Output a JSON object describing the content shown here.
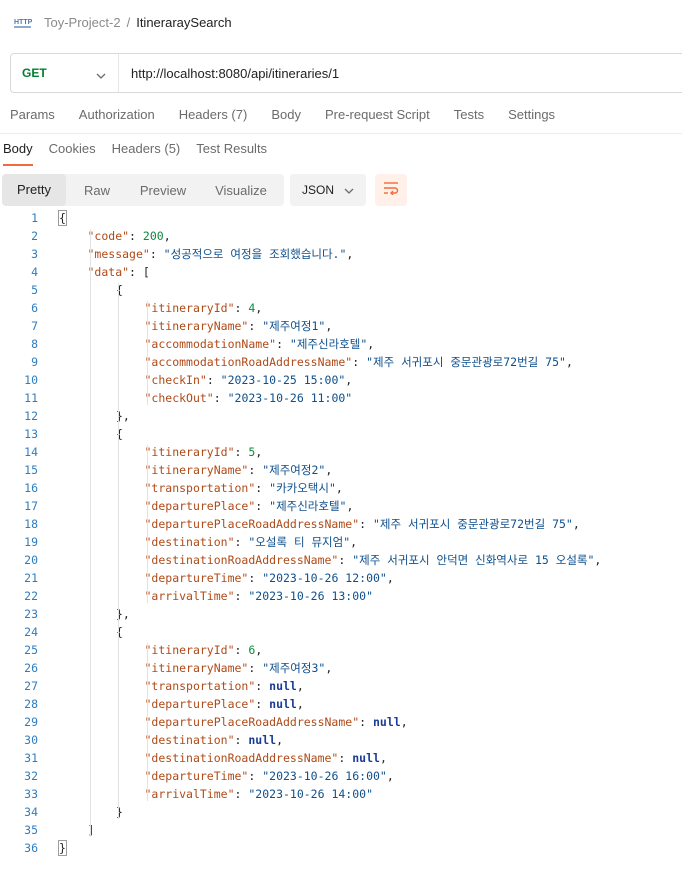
{
  "breadcrumb": {
    "icon": "http-icon",
    "parent": "Toy-Project-2",
    "separator": "/",
    "current": "ItineraraySearch"
  },
  "request": {
    "method": "GET",
    "url": "http://localhost:8080/api/itineraries/1"
  },
  "request_tabs": [
    "Params",
    "Authorization",
    "Headers (7)",
    "Body",
    "Pre-request Script",
    "Tests",
    "Settings"
  ],
  "response_tabs": [
    {
      "label": "Body",
      "active": true
    },
    {
      "label": "Cookies",
      "active": false
    },
    {
      "label": "Headers (5)",
      "active": false
    },
    {
      "label": "Test Results",
      "active": false
    }
  ],
  "view_modes": [
    "Pretty",
    "Raw",
    "Preview",
    "Visualize"
  ],
  "active_view_mode": "Pretty",
  "format": "JSON",
  "colors": {
    "accent": "#f26b3a",
    "method_get": "#007f31",
    "line_number": "#2f7dbf",
    "json_key": "#b04a17",
    "json_string": "#0e4f8c",
    "json_number": "#0c8a3a",
    "json_null": "#1a3c94"
  },
  "code_lines": [
    [
      {
        "t": "p",
        "v": "{"
      }
    ],
    [
      {
        "t": "k",
        "v": "\"code\""
      },
      {
        "t": "p",
        "v": ": "
      },
      {
        "t": "n",
        "v": "200"
      },
      {
        "t": "p",
        "v": ","
      }
    ],
    [
      {
        "t": "k",
        "v": "\"message\""
      },
      {
        "t": "p",
        "v": ": "
      },
      {
        "t": "s",
        "v": "\"성공적으로 여정을 조회했습니다.\""
      },
      {
        "t": "p",
        "v": ","
      }
    ],
    [
      {
        "t": "k",
        "v": "\"data\""
      },
      {
        "t": "p",
        "v": ": ["
      }
    ],
    [
      {
        "t": "p",
        "v": "{"
      }
    ],
    [
      {
        "t": "k",
        "v": "\"itineraryId\""
      },
      {
        "t": "p",
        "v": ": "
      },
      {
        "t": "n",
        "v": "4"
      },
      {
        "t": "p",
        "v": ","
      }
    ],
    [
      {
        "t": "k",
        "v": "\"itineraryName\""
      },
      {
        "t": "p",
        "v": ": "
      },
      {
        "t": "s",
        "v": "\"제주여정1\""
      },
      {
        "t": "p",
        "v": ","
      }
    ],
    [
      {
        "t": "k",
        "v": "\"accommodationName\""
      },
      {
        "t": "p",
        "v": ": "
      },
      {
        "t": "s",
        "v": "\"제주신라호텔\""
      },
      {
        "t": "p",
        "v": ","
      }
    ],
    [
      {
        "t": "k",
        "v": "\"accommodationRoadAddressName\""
      },
      {
        "t": "p",
        "v": ": "
      },
      {
        "t": "s",
        "v": "\"제주 서귀포시 중문관광로72번길 75\""
      },
      {
        "t": "p",
        "v": ","
      }
    ],
    [
      {
        "t": "k",
        "v": "\"checkIn\""
      },
      {
        "t": "p",
        "v": ": "
      },
      {
        "t": "s",
        "v": "\"2023-10-25 15:00\""
      },
      {
        "t": "p",
        "v": ","
      }
    ],
    [
      {
        "t": "k",
        "v": "\"checkOut\""
      },
      {
        "t": "p",
        "v": ": "
      },
      {
        "t": "s",
        "v": "\"2023-10-26 11:00\""
      }
    ],
    [
      {
        "t": "p",
        "v": "},"
      }
    ],
    [
      {
        "t": "p",
        "v": "{"
      }
    ],
    [
      {
        "t": "k",
        "v": "\"itineraryId\""
      },
      {
        "t": "p",
        "v": ": "
      },
      {
        "t": "n",
        "v": "5"
      },
      {
        "t": "p",
        "v": ","
      }
    ],
    [
      {
        "t": "k",
        "v": "\"itineraryName\""
      },
      {
        "t": "p",
        "v": ": "
      },
      {
        "t": "s",
        "v": "\"제주여정2\""
      },
      {
        "t": "p",
        "v": ","
      }
    ],
    [
      {
        "t": "k",
        "v": "\"transportation\""
      },
      {
        "t": "p",
        "v": ": "
      },
      {
        "t": "s",
        "v": "\"카카오택시\""
      },
      {
        "t": "p",
        "v": ","
      }
    ],
    [
      {
        "t": "k",
        "v": "\"departurePlace\""
      },
      {
        "t": "p",
        "v": ": "
      },
      {
        "t": "s",
        "v": "\"제주신라호텔\""
      },
      {
        "t": "p",
        "v": ","
      }
    ],
    [
      {
        "t": "k",
        "v": "\"departurePlaceRoadAddressName\""
      },
      {
        "t": "p",
        "v": ": "
      },
      {
        "t": "s",
        "v": "\"제주 서귀포시 중문관광로72번길 75\""
      },
      {
        "t": "p",
        "v": ","
      }
    ],
    [
      {
        "t": "k",
        "v": "\"destination\""
      },
      {
        "t": "p",
        "v": ": "
      },
      {
        "t": "s",
        "v": "\"오설록 티 뮤지엄\""
      },
      {
        "t": "p",
        "v": ","
      }
    ],
    [
      {
        "t": "k",
        "v": "\"destinationRoadAddressName\""
      },
      {
        "t": "p",
        "v": ": "
      },
      {
        "t": "s",
        "v": "\"제주 서귀포시 안덕면 신화역사로 15 오설록\""
      },
      {
        "t": "p",
        "v": ","
      }
    ],
    [
      {
        "t": "k",
        "v": "\"departureTime\""
      },
      {
        "t": "p",
        "v": ": "
      },
      {
        "t": "s",
        "v": "\"2023-10-26 12:00\""
      },
      {
        "t": "p",
        "v": ","
      }
    ],
    [
      {
        "t": "k",
        "v": "\"arrivalTime\""
      },
      {
        "t": "p",
        "v": ": "
      },
      {
        "t": "s",
        "v": "\"2023-10-26 13:00\""
      }
    ],
    [
      {
        "t": "p",
        "v": "},"
      }
    ],
    [
      {
        "t": "p",
        "v": "{"
      }
    ],
    [
      {
        "t": "k",
        "v": "\"itineraryId\""
      },
      {
        "t": "p",
        "v": ": "
      },
      {
        "t": "n",
        "v": "6"
      },
      {
        "t": "p",
        "v": ","
      }
    ],
    [
      {
        "t": "k",
        "v": "\"itineraryName\""
      },
      {
        "t": "p",
        "v": ": "
      },
      {
        "t": "s",
        "v": "\"제주여정3\""
      },
      {
        "t": "p",
        "v": ","
      }
    ],
    [
      {
        "t": "k",
        "v": "\"transportation\""
      },
      {
        "t": "p",
        "v": ": "
      },
      {
        "t": "kw",
        "v": "null"
      },
      {
        "t": "p",
        "v": ","
      }
    ],
    [
      {
        "t": "k",
        "v": "\"departurePlace\""
      },
      {
        "t": "p",
        "v": ": "
      },
      {
        "t": "kw",
        "v": "null"
      },
      {
        "t": "p",
        "v": ","
      }
    ],
    [
      {
        "t": "k",
        "v": "\"departurePlaceRoadAddressName\""
      },
      {
        "t": "p",
        "v": ": "
      },
      {
        "t": "kw",
        "v": "null"
      },
      {
        "t": "p",
        "v": ","
      }
    ],
    [
      {
        "t": "k",
        "v": "\"destination\""
      },
      {
        "t": "p",
        "v": ": "
      },
      {
        "t": "kw",
        "v": "null"
      },
      {
        "t": "p",
        "v": ","
      }
    ],
    [
      {
        "t": "k",
        "v": "\"destinationRoadAddressName\""
      },
      {
        "t": "p",
        "v": ": "
      },
      {
        "t": "kw",
        "v": "null"
      },
      {
        "t": "p",
        "v": ","
      }
    ],
    [
      {
        "t": "k",
        "v": "\"departureTime\""
      },
      {
        "t": "p",
        "v": ": "
      },
      {
        "t": "s",
        "v": "\"2023-10-26 16:00\""
      },
      {
        "t": "p",
        "v": ","
      }
    ],
    [
      {
        "t": "k",
        "v": "\"arrivalTime\""
      },
      {
        "t": "p",
        "v": ": "
      },
      {
        "t": "s",
        "v": "\"2023-10-26 14:00\""
      }
    ],
    [
      {
        "t": "p",
        "v": "}"
      }
    ],
    [
      {
        "t": "p",
        "v": "]"
      }
    ],
    [
      {
        "t": "p",
        "v": "}"
      }
    ]
  ]
}
